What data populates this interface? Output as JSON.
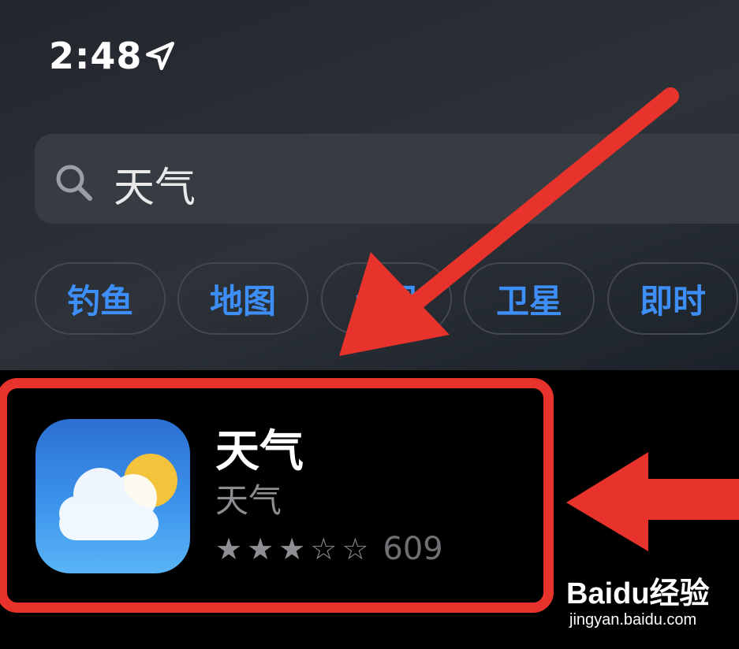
{
  "status_bar": {
    "time": "2:48"
  },
  "search": {
    "value": "天气"
  },
  "chips": [
    {
      "label": "钓鱼"
    },
    {
      "label": "地图"
    },
    {
      "label": "台风"
    },
    {
      "label": "卫星"
    },
    {
      "label": "即时"
    }
  ],
  "result": {
    "app_name": "天气",
    "subtitle": "天气",
    "rating_stars": 3,
    "rating_max": 5,
    "rating_count": "609"
  },
  "watermark": {
    "brand": "Baidu经验",
    "url": "jingyan.baidu.com"
  },
  "colors": {
    "annotation_red": "#e8332c",
    "chip_text": "#3d8ef7",
    "icon_blue": "#3c94ec",
    "sun_yellow": "#f3c33c"
  }
}
